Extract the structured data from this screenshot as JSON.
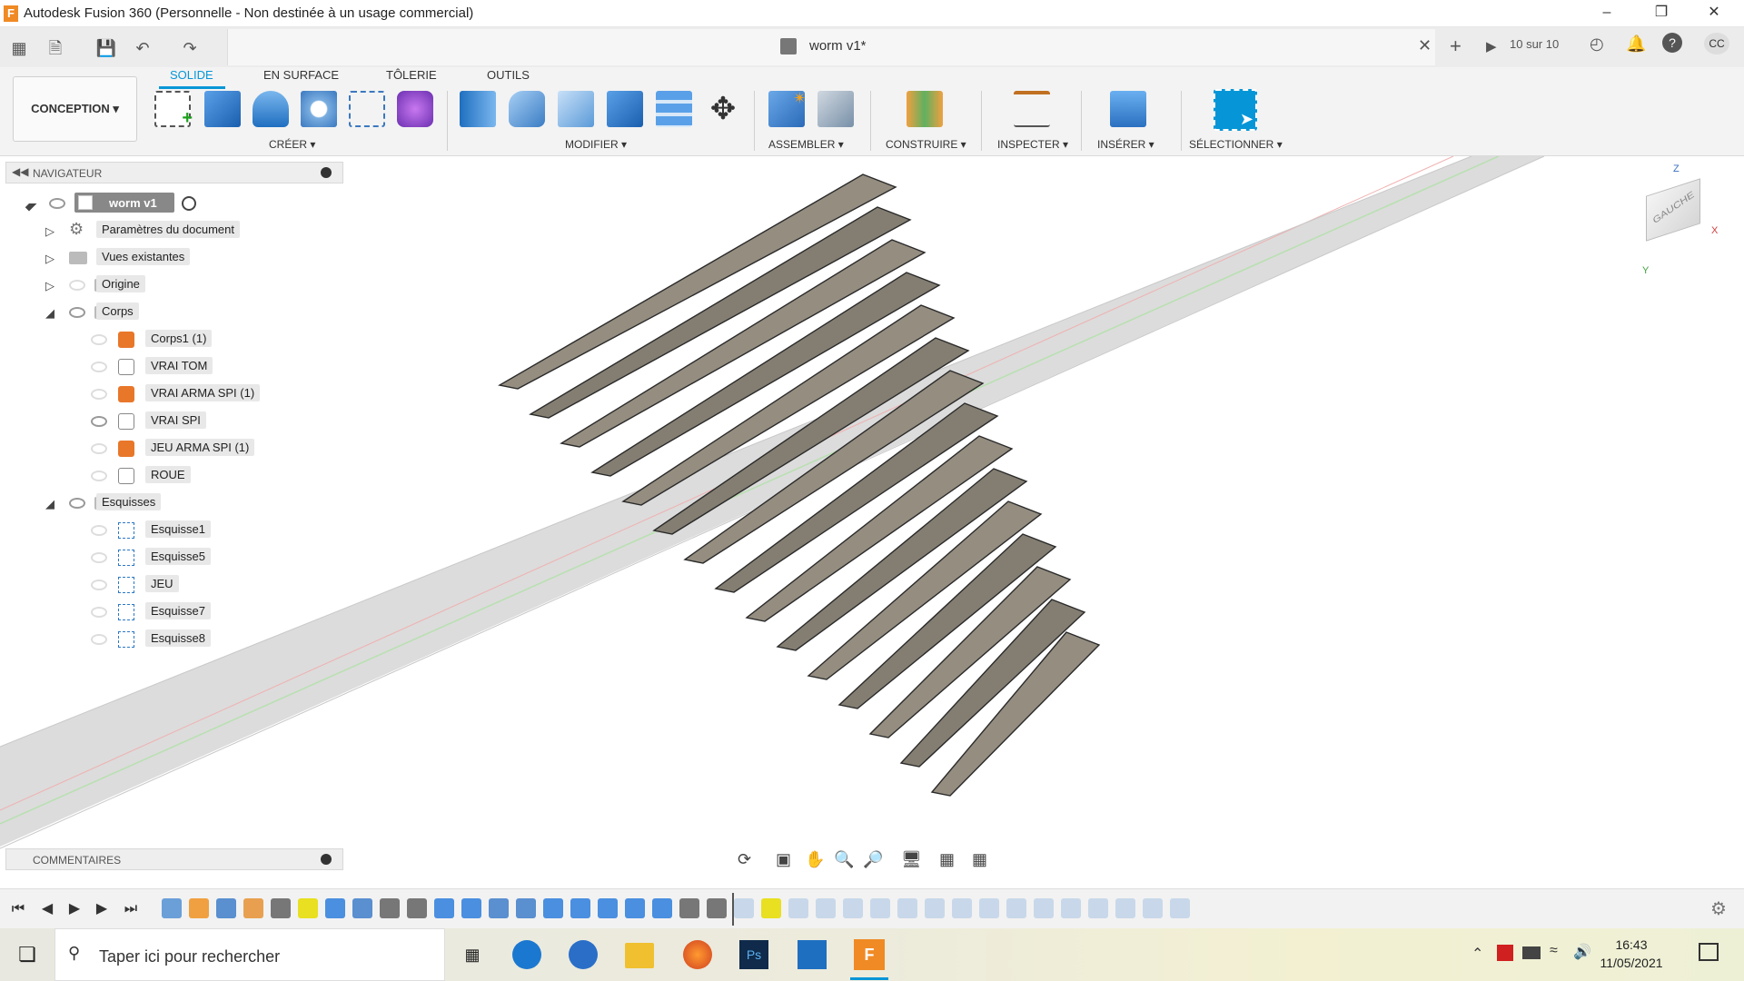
{
  "window": {
    "title": "Autodesk Fusion 360 (Personnelle - Non destinée à un usage commercial)",
    "app_icon": "F"
  },
  "quick_access": {
    "doc_title": "worm v1*",
    "jobs_label": "10 sur 10",
    "user_initials": "CC"
  },
  "workspace": {
    "label": "CONCEPTION"
  },
  "tabs": [
    "SOLIDE",
    "EN SURFACE",
    "TÔLERIE",
    "OUTILS"
  ],
  "tool_groups": {
    "create": "CRÉER",
    "modify": "MODIFIER",
    "assemble": "ASSEMBLER",
    "construct": "CONSTRUIRE",
    "inspect": "INSPECTER",
    "insert": "INSÉRER",
    "select": "SÉLECTIONNER"
  },
  "navigator": {
    "title": "NAVIGATEUR",
    "root": "worm v1",
    "items": [
      {
        "label": "Paramètres du document",
        "level": 1,
        "icon": "gear-icon"
      },
      {
        "label": "Vues existantes",
        "level": 1,
        "icon": "folder-icon"
      },
      {
        "label": "Origine",
        "level": 1,
        "icon": "folder-icon"
      },
      {
        "label": "Corps",
        "level": 1,
        "icon": "folder-icon"
      },
      {
        "label": "Corps1 (1)",
        "level": 2,
        "icon": "body-orange-icon"
      },
      {
        "label": "VRAI TOM",
        "level": 2,
        "icon": "body-white-icon"
      },
      {
        "label": "VRAI ARMA SPI (1)",
        "level": 2,
        "icon": "body-orange-icon"
      },
      {
        "label": "VRAI SPI",
        "level": 2,
        "icon": "body-white-icon"
      },
      {
        "label": "JEU ARMA SPI  (1)",
        "level": 2,
        "icon": "body-orange-icon"
      },
      {
        "label": "ROUE",
        "level": 2,
        "icon": "body-white-icon"
      },
      {
        "label": "Esquisses",
        "level": 1,
        "icon": "folder-icon"
      },
      {
        "label": "Esquisse1",
        "level": 2,
        "icon": "sketch-icon"
      },
      {
        "label": "Esquisse5",
        "level": 2,
        "icon": "sketch-icon"
      },
      {
        "label": "JEU",
        "level": 2,
        "icon": "sketch-icon"
      },
      {
        "label": "Esquisse7",
        "level": 2,
        "icon": "sketch-icon"
      },
      {
        "label": "Esquisse8",
        "level": 2,
        "icon": "sketch-icon"
      }
    ]
  },
  "viewcube": {
    "face": "GAUCHE",
    "axis_z": "Z",
    "axis_x": "X",
    "axis_y": "Y"
  },
  "comments": {
    "title": "COMMENTAIRES"
  },
  "taskbar": {
    "search_placeholder": "Taper ici pour rechercher",
    "time": "16:43",
    "date": "11/05/2021"
  },
  "colors": {
    "accent": "#0696d7",
    "fusion_orange": "#f08a24"
  }
}
